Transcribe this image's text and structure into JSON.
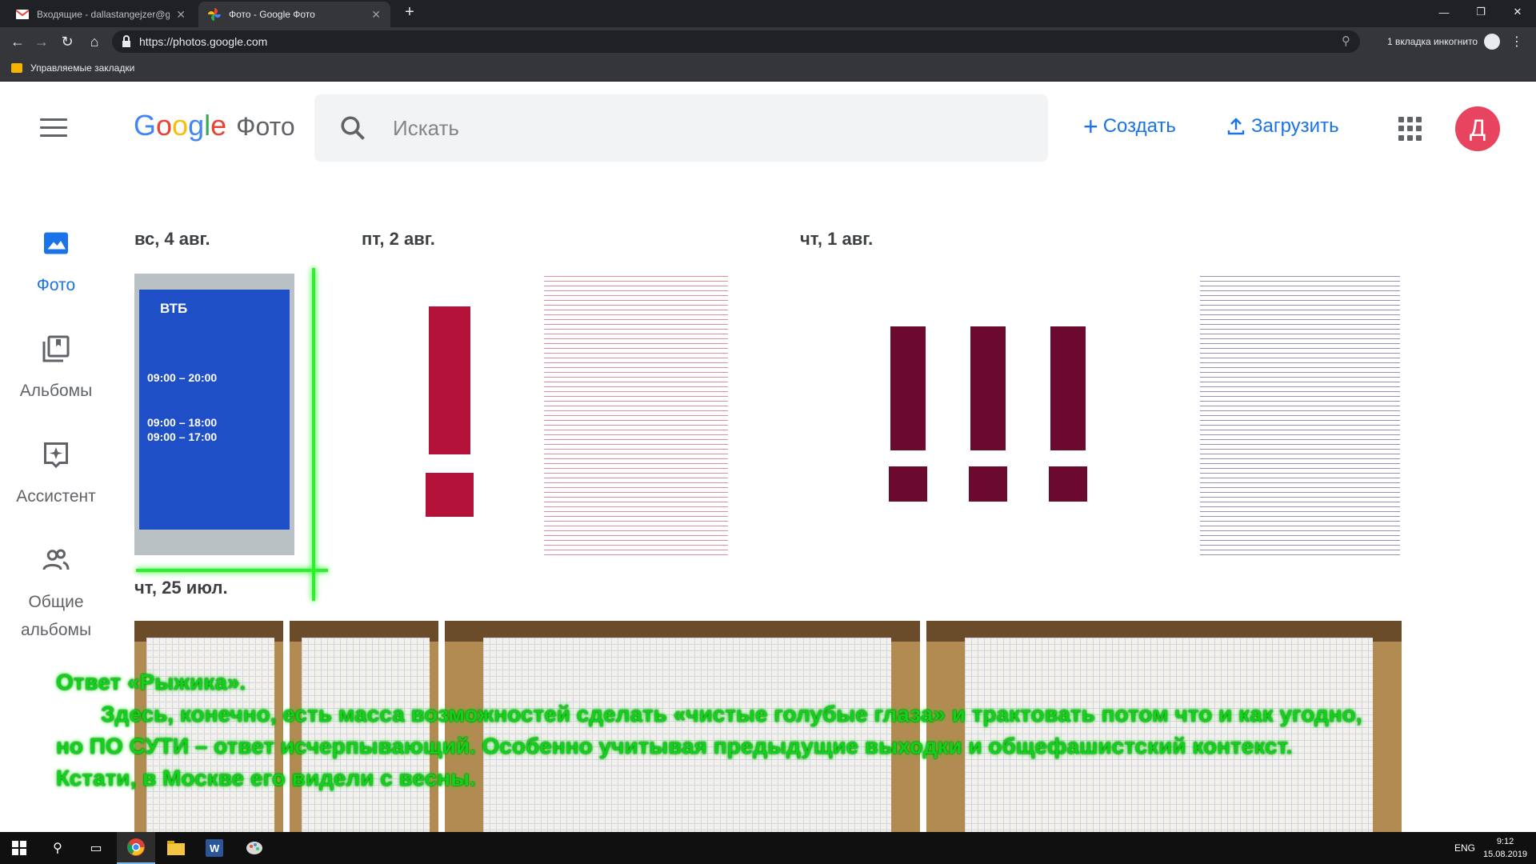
{
  "browser": {
    "tabs": [
      {
        "title": "Входящие - dallastangejzer@gm",
        "favicon": "gmail-icon"
      },
      {
        "title": "Фото - Google Фото",
        "favicon": "google-photos-icon"
      }
    ],
    "url": "https://photos.google.com",
    "incognito_label": "1 вкладка инкогнито",
    "bookmark_folder": "Управляемые закладки"
  },
  "header": {
    "logo_letters": [
      "G",
      "o",
      "o",
      "g",
      "l",
      "e"
    ],
    "product_name": "Фото",
    "search_placeholder": "Искать",
    "create_label": "Создать",
    "upload_label": "Загрузить",
    "avatar_letter": "Д"
  },
  "sidebar": {
    "items": [
      {
        "label": "Фото",
        "icon": "photo-icon",
        "active": true
      },
      {
        "label": "Альбомы",
        "icon": "albums-icon",
        "active": false
      },
      {
        "label": "Ассистент",
        "icon": "assistant-icon",
        "active": false
      },
      {
        "label": "Общие альбомы",
        "icon": "shared-albums-icon",
        "active": false
      }
    ]
  },
  "timeline": {
    "groups": [
      {
        "date": "вс, 4 авг."
      },
      {
        "date": "пт, 2 авг."
      },
      {
        "date": "чт, 1 авг."
      },
      {
        "date": "чт, 25 июл."
      }
    ],
    "vtb_photo": {
      "brand": "ВТБ",
      "hours": [
        "09:00 – 20:00",
        "09:00 – 18:00",
        "09:00 – 17:00"
      ]
    }
  },
  "overlay_text": {
    "line1": "Ответ «Рыжика».",
    "line2": "Здесь, конечно, есть масса возможностей сделать «чистые голубые глаза» и трактовать потом что и как угодно,",
    "line3": "но ПО СУТИ – ответ исчерпывающий. Особенно учитывая предыдущие выходки и общефашистский контекст.",
    "line4": "Кстати, в Москве его видели с весны."
  },
  "colors": {
    "accent": "#1a73e8",
    "exclamation": "#b5123a",
    "exclamation_dark": "#6b0a2e",
    "overlay_green": "#11d21b",
    "avatar_bg": "#e8435f"
  },
  "taskbar": {
    "lang": "ENG",
    "time": "9:12",
    "date": "15.08.2019"
  }
}
